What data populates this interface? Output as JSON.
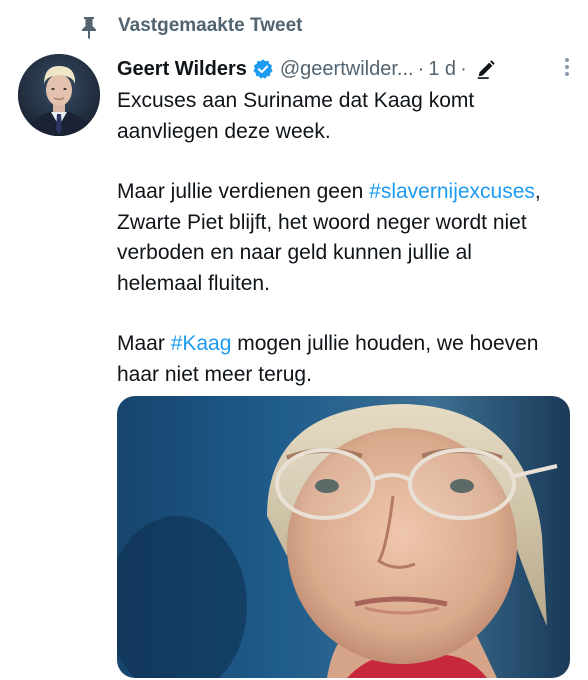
{
  "pinned": {
    "label": "Vastgemaakte Tweet",
    "icon": "pin-icon"
  },
  "author": {
    "name": "Geert Wilders",
    "handle": "@geertwilder...",
    "verified_icon": "verified-badge-icon"
  },
  "meta": {
    "separator": "·",
    "time": "1 d",
    "edit_icon": "pencil-icon",
    "more_icon": "more-vertical-icon"
  },
  "tweet": {
    "p1": "Excuses aan Suriname dat Kaag komt aanvliegen deze week.",
    "p2_before": "Maar jullie verdienen geen ",
    "p2_hashtag": "#slavernijexcuses",
    "p2_after": ", Zwarte Piet blijft, het woord neger wordt niet verboden en naar geld kunnen jullie al helemaal fluiten.",
    "p3_before": "Maar ",
    "p3_hashtag": "#Kaag",
    "p3_after": " mogen jullie houden, we hoeven haar niet meer terug."
  },
  "colors": {
    "accent": "#1d9bf0",
    "text_primary": "#0f1419",
    "text_secondary": "#536471",
    "background": "#ffffff"
  }
}
